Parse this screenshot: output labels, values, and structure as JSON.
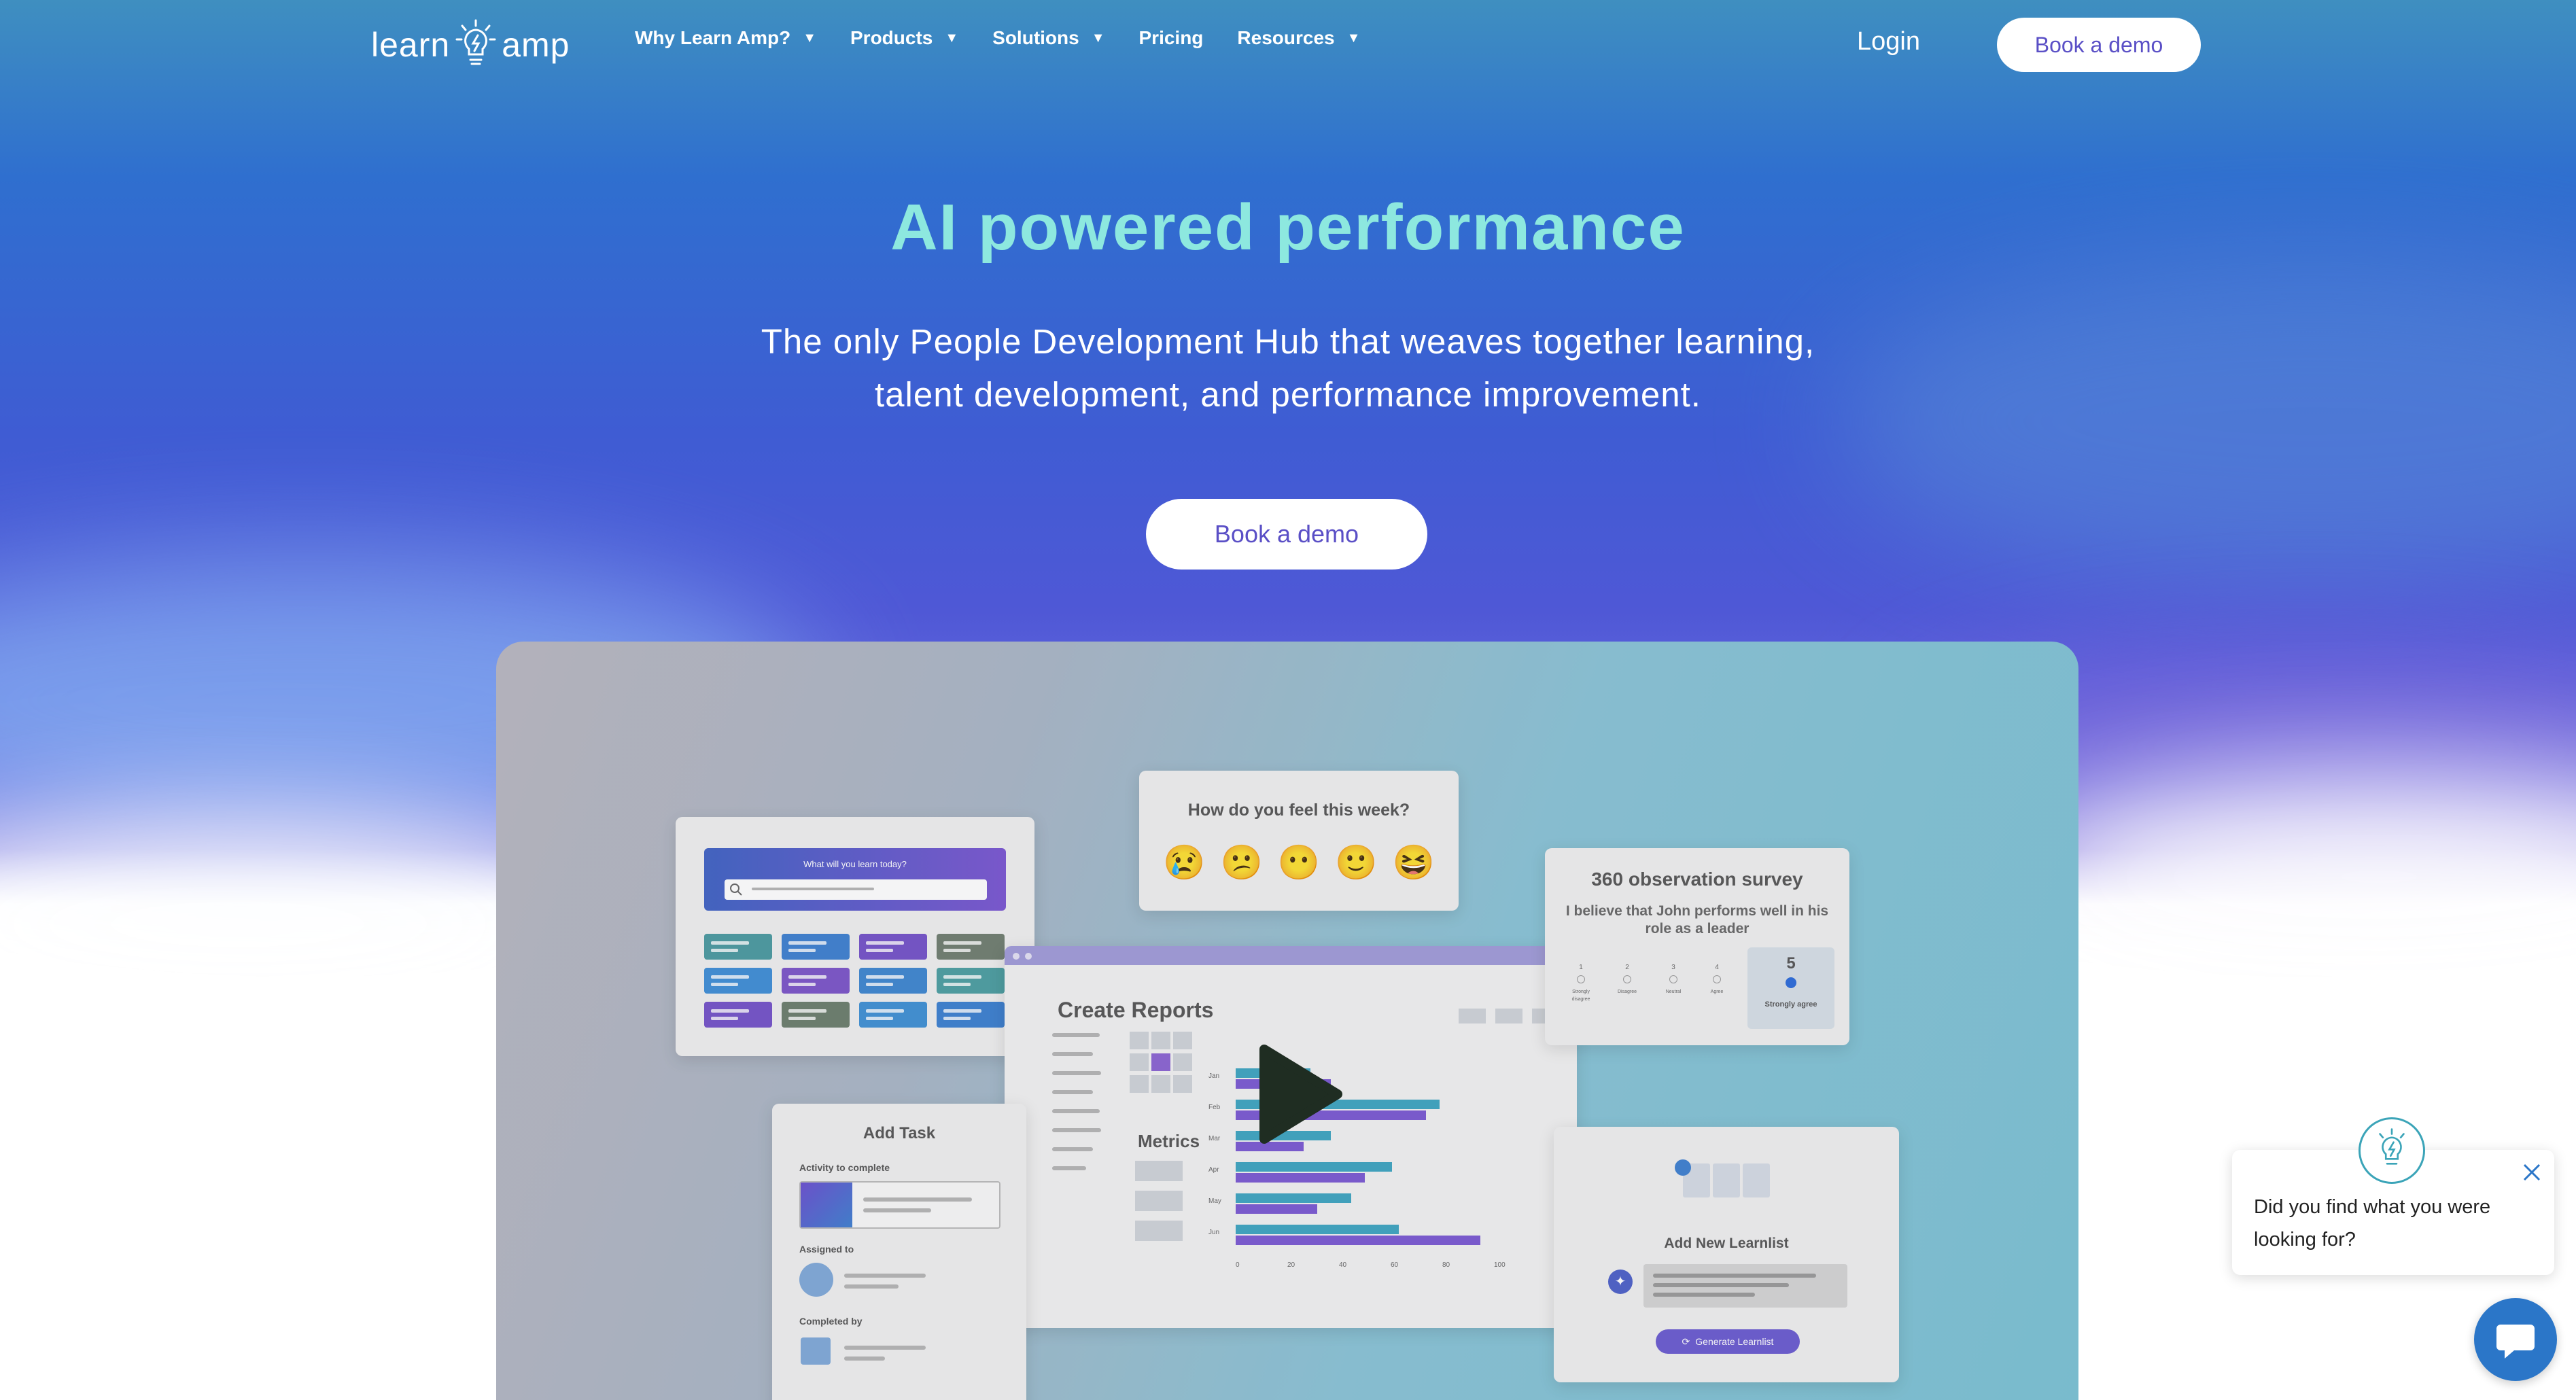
{
  "brand": {
    "logo_left": "learn",
    "logo_right": "amp"
  },
  "nav": {
    "items": [
      {
        "label": "Why Learn Amp?",
        "has_dropdown": true
      },
      {
        "label": "Products",
        "has_dropdown": true
      },
      {
        "label": "Solutions",
        "has_dropdown": true
      },
      {
        "label": "Pricing",
        "has_dropdown": false
      },
      {
        "label": "Resources",
        "has_dropdown": true
      }
    ],
    "login": "Login",
    "cta": "Book a demo"
  },
  "hero": {
    "title": "AI powered performance",
    "subtitle_line1": "The only People Development Hub that weaves together learning,",
    "subtitle_line2": "talent development, and performance improvement.",
    "cta": "Book a demo"
  },
  "video": {
    "learn_card": {
      "question": "What will you learn today?"
    },
    "feel_card": {
      "question": "How do you feel this week?",
      "emojis": [
        "😢",
        "😕",
        "😶",
        "🙂",
        "😆"
      ]
    },
    "survey_card": {
      "title": "360 observation survey",
      "statement": "I believe that John performs well in his role as a leader",
      "scale": [
        {
          "n": "1",
          "label": "Strongly disagree"
        },
        {
          "n": "2",
          "label": "Disagree"
        },
        {
          "n": "3",
          "label": "Neutral"
        },
        {
          "n": "4",
          "label": "Agree"
        }
      ],
      "selected": {
        "n": "5",
        "label": "Strongly agree"
      }
    },
    "reports_card": {
      "title": "Create Reports",
      "metrics_label": "Metrics",
      "months": [
        "Jan",
        "Feb",
        "Mar",
        "Apr",
        "May",
        "Jun"
      ],
      "x_ticks": [
        "0",
        "20",
        "40",
        "60",
        "80",
        "100"
      ]
    },
    "task_card": {
      "title": "Add Task",
      "activity_label": "Activity to complete",
      "assigned_label": "Assigned to",
      "completed_label": "Completed by"
    },
    "learnlist_card": {
      "title": "Add New Learnlist",
      "button": "Generate Learnlist"
    }
  },
  "chat": {
    "message": "Did you find what you were looking for?"
  },
  "colors": {
    "accent": "#5a4fc6",
    "title": "#8de8df",
    "chat": "#2b76c8"
  }
}
